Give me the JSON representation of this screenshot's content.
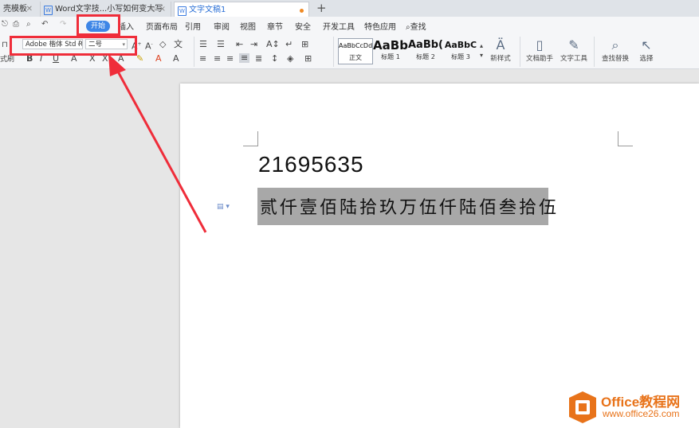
{
  "tabs": [
    {
      "label": "壳模板",
      "close": "✕"
    },
    {
      "label": "Word文字技...小写如何变大写",
      "close": "×"
    },
    {
      "label": "文字文稿1"
    }
  ],
  "new_tab": "+",
  "menu": {
    "start": "开始",
    "items": [
      "插入",
      "页面布局",
      "引用",
      "审阅",
      "视图",
      "章节",
      "安全",
      "开发工具",
      "特色应用"
    ],
    "search": "查找"
  },
  "ribbon": {
    "font_name": "Adobe 楷体 Std R",
    "font_size": "二号",
    "left_cut_label": "式刷",
    "styles": [
      {
        "preview": "AaBbCcDd",
        "caption": "正文"
      },
      {
        "preview": "AaBb",
        "caption": "标题 1"
      },
      {
        "preview": "AaBb(",
        "caption": "标题 2"
      },
      {
        "preview": "AaBbC",
        "caption": "标题 3"
      }
    ],
    "tools": [
      "新样式",
      "文档助手",
      "文字工具",
      "查找替换",
      "选择"
    ]
  },
  "document": {
    "number": "21695635",
    "uppercase": "贰仟壹佰陆拾玖万伍仟陆佰叁拾伍"
  },
  "watermark": {
    "title": "Office教程网",
    "url": "www.office26.com"
  },
  "colors": {
    "accent": "#3e86e6",
    "annotation_red": "#ef2d3a",
    "logo_orange": "#e8731a",
    "selection_gray": "#a8a8a8"
  }
}
